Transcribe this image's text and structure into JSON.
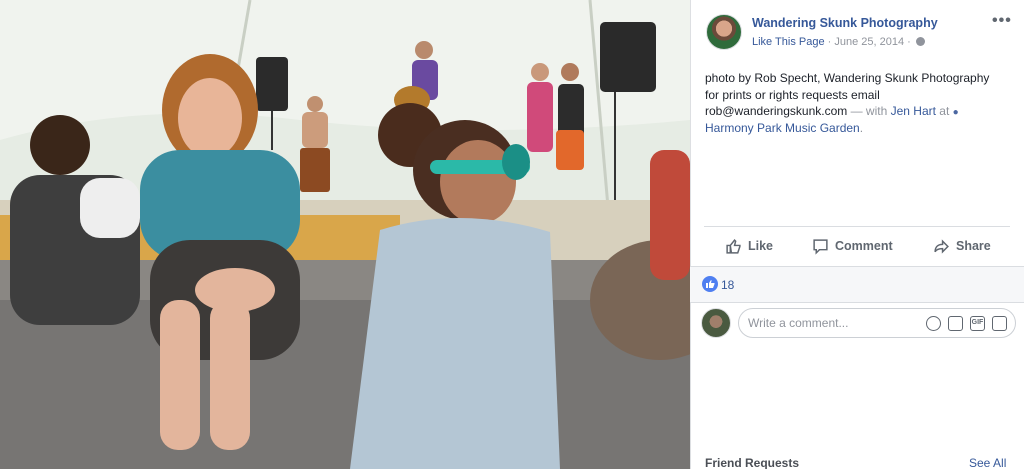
{
  "post": {
    "page_name": "Wandering Skunk Photography",
    "like_this_page": "Like This Page",
    "separator": " · ",
    "date": "June 25, 2014",
    "separator2": " · ",
    "more": "•••",
    "caption_line1": "photo by Rob Specht, Wandering Skunk Photography",
    "caption_line2": "for prints or rights requests email",
    "email": "rob@wanderingskunk.com",
    "with_text": " — with ",
    "tagged_person": "Jen Hart",
    "at_text": " at ",
    "location": "Harmony Park Music Garden",
    "period": "."
  },
  "actions": {
    "like": "Like",
    "comment": "Comment",
    "share": "Share"
  },
  "reactions": {
    "count": "18"
  },
  "comment_input": {
    "placeholder": "Write a comment..."
  },
  "sidebar_footer": {
    "friend_requests": "Friend Requests",
    "see_all": "See All"
  },
  "icons": [
    "globe-icon",
    "more-icon",
    "pin-icon",
    "like-icon",
    "comment-icon",
    "share-icon",
    "like-reaction-icon",
    "emoji-icon",
    "camera-icon",
    "gif-icon",
    "sticker-icon"
  ],
  "colors": {
    "link": "#365899",
    "meta": "#90949c",
    "action_text": "#606770",
    "like_blue": "#4f7ff1"
  }
}
